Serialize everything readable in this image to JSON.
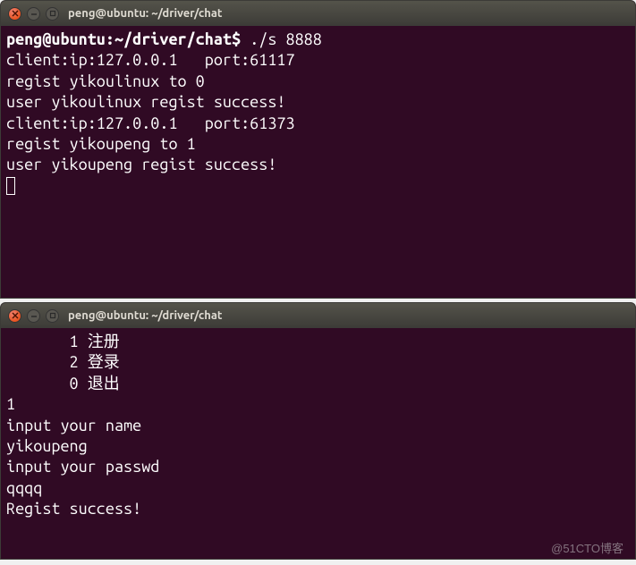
{
  "terminal1": {
    "title": "peng@ubuntu: ~/driver/chat",
    "prompt": "peng@ubuntu:~/driver/chat$",
    "command": "./s 8888",
    "lines": [
      "client:ip:127.0.0.1   port:61117",
      "regist yikoulinux to 0",
      "user yikoulinux regist success!",
      "client:ip:127.0.0.1   port:61373",
      "regist yikoupeng to 1",
      "user yikoupeng regist success!"
    ]
  },
  "terminal2": {
    "title": "peng@ubuntu: ~/driver/chat",
    "menu": [
      "       1 注册",
      "       2 登录",
      "       0 退出"
    ],
    "lines": [
      "1",
      "input your name",
      "yikoupeng",
      "input your passwd",
      "qqqq",
      "Regist success!"
    ]
  },
  "watermark": "@51CTO博客"
}
